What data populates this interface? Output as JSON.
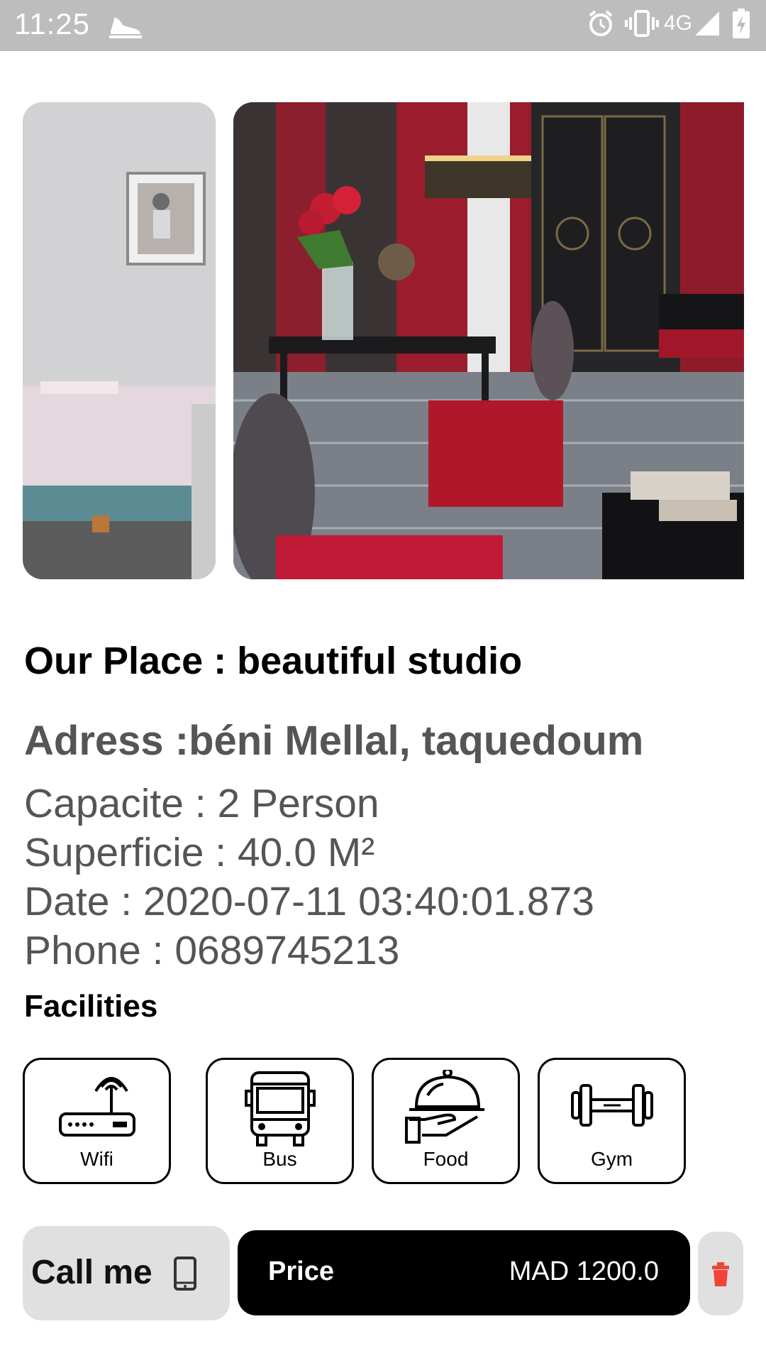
{
  "status_bar": {
    "time": "11:25",
    "network": "4G",
    "icons": [
      "running-shoe-icon",
      "alarm-icon",
      "vibrate-icon",
      "signal-icon",
      "battery-charging-icon"
    ]
  },
  "gallery": {
    "images": [
      "hotel-room-bed-photo",
      "hotel-suite-red-chairs-photo"
    ]
  },
  "place": {
    "title": "Our Place : beautiful studio",
    "address": "Adress :béni Mellal, taquedoum",
    "capacity": "Capacite : 2 Person",
    "surface": "Superficie : 40.0 M²",
    "date": "Date : 2020-07-11 03:40:01.873",
    "phone": "Phone : 0689745213"
  },
  "facilities": {
    "title": "Facilities",
    "items": [
      {
        "label": "Wifi",
        "icon": "wifi-router-icon"
      },
      {
        "label": "Bus",
        "icon": "bus-icon"
      },
      {
        "label": "Food",
        "icon": "food-cloche-icon"
      },
      {
        "label": "Gym",
        "icon": "dumbbell-icon"
      }
    ]
  },
  "actions": {
    "call_label": "Call me",
    "price_label": "Price",
    "price_value": "MAD 1200.0"
  },
  "colors": {
    "status_bar": "#bdbdbd",
    "price_bar": "#000000",
    "delete_icon": "#f44336",
    "secondary_text": "#555555"
  }
}
